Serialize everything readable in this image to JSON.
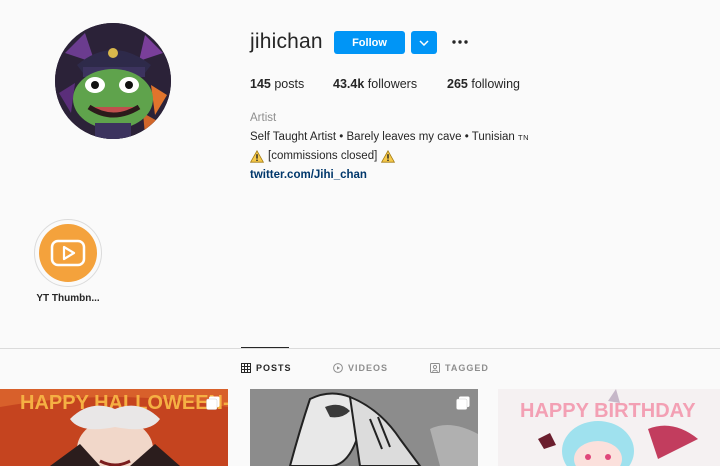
{
  "profile": {
    "username": "jihichan",
    "follow_label": "Follow",
    "posts_count": "145",
    "posts_label": "posts",
    "followers_count": "43.4k",
    "followers_label": "followers",
    "following_count": "265",
    "following_label": "following"
  },
  "bio": {
    "category": "Artist",
    "line1": "Self Taught Artist • Barely leaves my cave • Tunisian",
    "flag_code": "TN",
    "line2": "[commissions closed]",
    "link": "twitter.com/Jihi_chan"
  },
  "highlights": [
    {
      "label": "YT Thumbn...",
      "icon": "play-icon",
      "color": "#f4a23c"
    }
  ],
  "tabs": [
    {
      "label": "POSTS",
      "icon": "grid-icon",
      "active": true
    },
    {
      "label": "VIDEOS",
      "icon": "video-icon",
      "active": false
    },
    {
      "label": "TAGGED",
      "icon": "tagged-icon",
      "active": false
    }
  ],
  "posts": [
    {
      "text": "HAPPY HALLOWEEN-ish",
      "bg": "#c5441f",
      "badge": "multiple-icon"
    },
    {
      "text": "",
      "bg": "#8a8a8a",
      "badge": "multiple-icon"
    },
    {
      "text": "HAPPY BIRTHDAY",
      "bg": "#f3eef0",
      "badge": ""
    }
  ],
  "colors": {
    "accent": "#0095f6",
    "link": "#00376b",
    "muted": "#8e8e8e"
  }
}
